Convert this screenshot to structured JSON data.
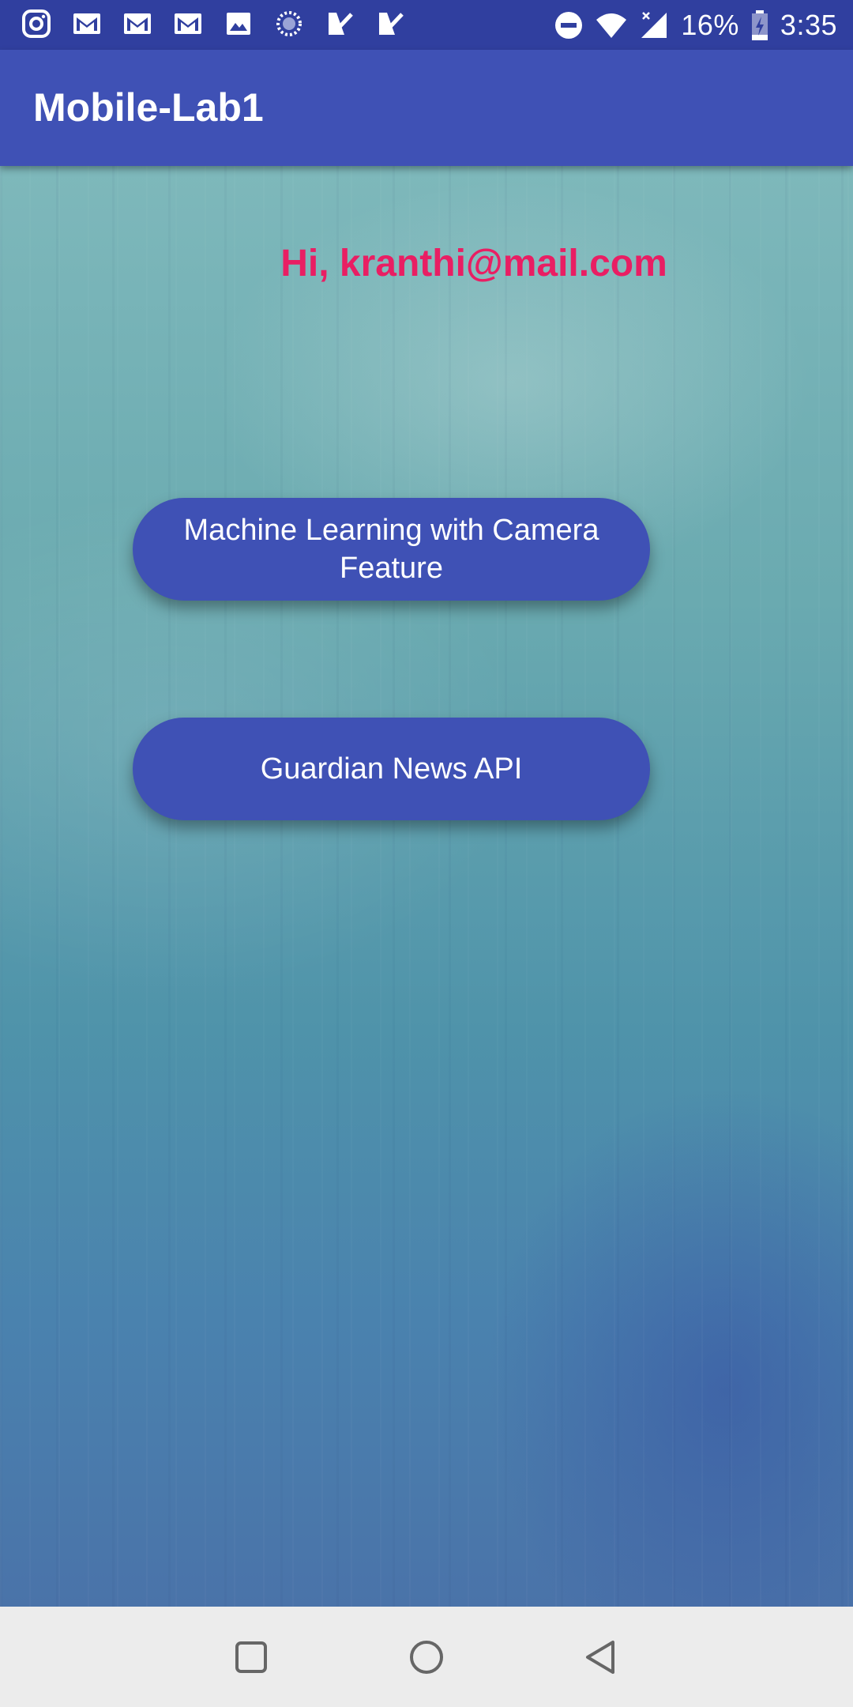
{
  "status_bar": {
    "battery_percent": "16%",
    "time": "3:35",
    "notification_icons": [
      "instagram-icon",
      "gmail-icon",
      "gmail-icon",
      "gmail-icon",
      "image-icon",
      "sync-icon",
      "task-check-icon",
      "task-check-icon"
    ],
    "system_icons": [
      "do-not-disturb-icon",
      "wifi-icon",
      "signal-icon",
      "battery-charging-icon"
    ]
  },
  "app_bar": {
    "title": "Mobile-Lab1"
  },
  "main": {
    "greeting": "Hi, kranthi@mail.com",
    "buttons": {
      "ml_camera": "Machine Learning with Camera Feature",
      "guardian_news": "Guardian News API"
    }
  },
  "colors": {
    "primary": "#3f51b5",
    "primary_dark": "#303f9f",
    "accent": "#e91e63",
    "nav_bar": "#ececec"
  },
  "nav_bar": {
    "icons": [
      "recents-icon",
      "home-icon",
      "back-icon"
    ]
  }
}
